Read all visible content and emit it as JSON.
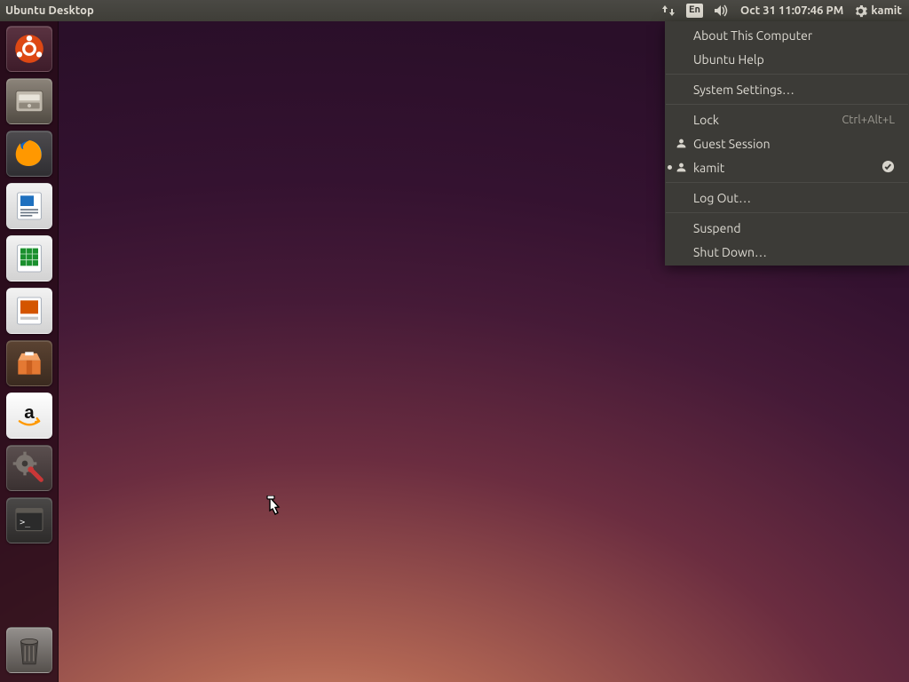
{
  "panel": {
    "title": "Ubuntu Desktop",
    "language_badge": "En",
    "datetime": "Oct 31 11:07:46 PM",
    "session_user": "kamit"
  },
  "launcher": {
    "items": [
      {
        "name": "dash",
        "label": "Dash"
      },
      {
        "name": "files",
        "label": "Files"
      },
      {
        "name": "firefox",
        "label": "Firefox Web Browser"
      },
      {
        "name": "writer",
        "label": "LibreOffice Writer"
      },
      {
        "name": "calc",
        "label": "LibreOffice Calc"
      },
      {
        "name": "impress",
        "label": "LibreOffice Impress"
      },
      {
        "name": "software",
        "label": "Ubuntu Software Center"
      },
      {
        "name": "amazon",
        "label": "Amazon"
      },
      {
        "name": "settings",
        "label": "System Settings"
      },
      {
        "name": "terminal",
        "label": "Terminal"
      }
    ],
    "trash_label": "Trash"
  },
  "menu": {
    "about": "About This Computer",
    "help": "Ubuntu Help",
    "settings": "System Settings…",
    "lock": "Lock",
    "lock_accel": "Ctrl+Alt+L",
    "guest": "Guest Session",
    "user": "kamit",
    "logout": "Log Out…",
    "suspend": "Suspend",
    "shutdown": "Shut Down…"
  }
}
